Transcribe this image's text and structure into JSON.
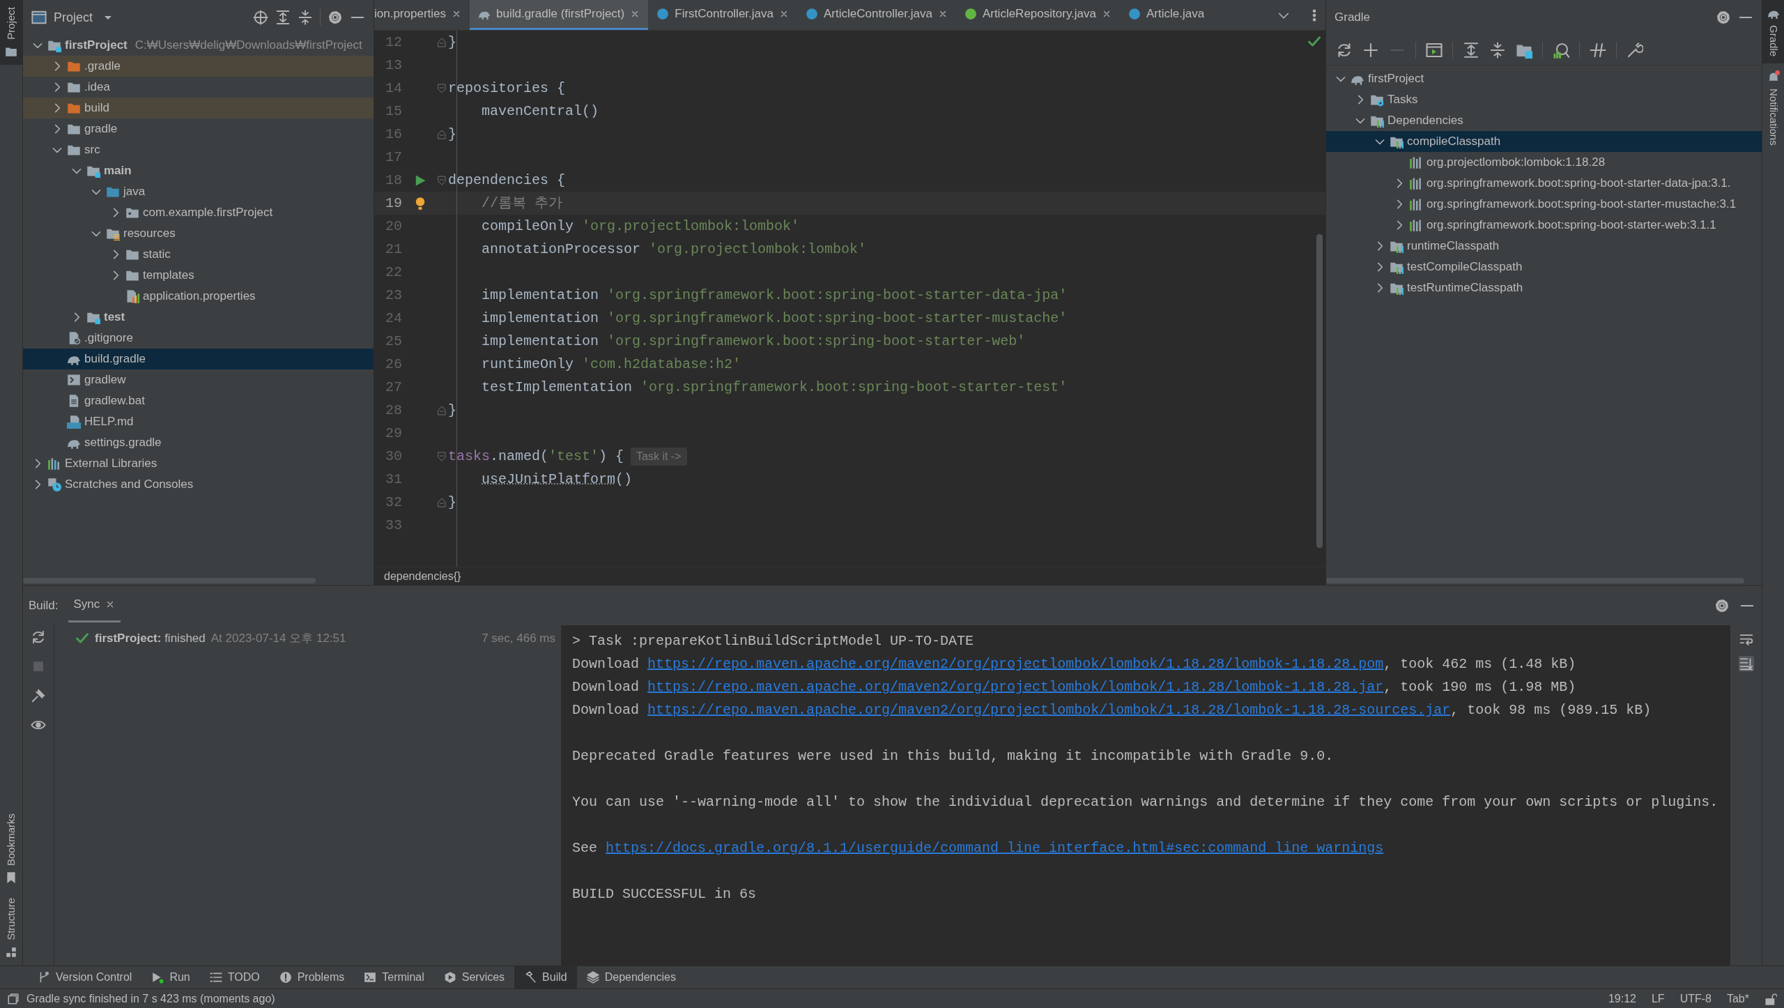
{
  "left_stripe": {
    "top": [
      {
        "label": "Project",
        "selected": true
      }
    ],
    "bottom": [
      {
        "label": "Bookmarks",
        "selected": false
      },
      {
        "label": "Structure",
        "selected": false
      }
    ]
  },
  "right_stripe": [
    {
      "label": "Gradle",
      "selected": true,
      "kind": "gradle",
      "unread": false
    },
    {
      "label": "Notifications",
      "selected": false,
      "kind": "bell",
      "unread": true
    }
  ],
  "project_panel": {
    "title": "Project",
    "tree": [
      {
        "label": "firstProject",
        "kind": "module",
        "path": "C:₩Users₩delig₩Downloads₩firstProject",
        "expanded": true,
        "selected": false,
        "excluded": false,
        "children": [
          {
            "label": ".gradle",
            "kind": "excluded",
            "expanded": false,
            "selected": false,
            "excluded": true
          },
          {
            "label": ".idea",
            "kind": "folder",
            "expanded": false,
            "selected": false,
            "excluded": false
          },
          {
            "label": "build",
            "kind": "excluded",
            "expanded": false,
            "selected": false,
            "excluded": true
          },
          {
            "label": "gradle",
            "kind": "folder",
            "expanded": false,
            "selected": false,
            "excluded": false
          },
          {
            "label": "src",
            "kind": "folder",
            "expanded": true,
            "selected": false,
            "excluded": false,
            "children": [
              {
                "label": "main",
                "kind": "module",
                "expanded": true,
                "selected": false,
                "excluded": false,
                "children": [
                  {
                    "label": "java",
                    "kind": "source",
                    "expanded": true,
                    "selected": false,
                    "excluded": false,
                    "children": [
                      {
                        "label": "com.example.firstProject",
                        "kind": "package",
                        "expanded": false,
                        "selected": false,
                        "excluded": false
                      }
                    ]
                  },
                  {
                    "label": "resources",
                    "kind": "resources",
                    "expanded": true,
                    "selected": false,
                    "excluded": false,
                    "children": [
                      {
                        "label": "static",
                        "kind": "folder",
                        "expanded": false,
                        "selected": false,
                        "excluded": false
                      },
                      {
                        "label": "templates",
                        "kind": "folder",
                        "expanded": false,
                        "selected": false,
                        "excluded": false
                      },
                      {
                        "label": "application.properties",
                        "kind": "properties",
                        "selected": false,
                        "excluded": false
                      }
                    ]
                  }
                ]
              },
              {
                "label": "test",
                "kind": "module",
                "expanded": false,
                "selected": false,
                "excluded": false
              }
            ]
          },
          {
            "label": ".gitignore",
            "kind": "gitignore",
            "selected": false,
            "excluded": false
          },
          {
            "label": "build.gradle",
            "kind": "gradle",
            "selected": true,
            "excluded": false
          },
          {
            "label": "gradlew",
            "kind": "script",
            "selected": false,
            "excluded": false
          },
          {
            "label": "gradlew.bat",
            "kind": "text",
            "selected": false,
            "excluded": false
          },
          {
            "label": "HELP.md",
            "kind": "markdown",
            "selected": false,
            "excluded": false
          },
          {
            "label": "settings.gradle",
            "kind": "gradle",
            "selected": false,
            "excluded": false
          }
        ]
      },
      {
        "label": "External Libraries",
        "kind": "libraries",
        "expanded": false,
        "selected": false,
        "excluded": false
      },
      {
        "label": "Scratches and Consoles",
        "kind": "scratches",
        "expanded": false,
        "selected": false,
        "excluded": false
      }
    ]
  },
  "editor": {
    "tabs": [
      {
        "label": "ion.properties",
        "selected": false,
        "closable": true
      },
      {
        "label": "build.gradle (firstProject)",
        "kind": "gradle",
        "selected": true,
        "closable": true
      },
      {
        "label": "FirstController.java",
        "kind": "class",
        "selected": false,
        "closable": true
      },
      {
        "label": "ArticleController.java",
        "kind": "class",
        "selected": false,
        "closable": true
      },
      {
        "label": "ArticleRepository.java",
        "kind": "interface",
        "selected": false,
        "closable": true
      },
      {
        "label": "Article.java",
        "kind": "class",
        "selected": false,
        "closable": false
      }
    ],
    "lines": [
      {
        "number": "12",
        "current": false,
        "fold_start": false,
        "fold_end": true,
        "run_marker": false,
        "bulb": false,
        "tokens": [
          {
            "text": "}",
            "kind": "plain"
          }
        ]
      },
      {
        "number": "13",
        "current": false,
        "fold_start": false,
        "fold_end": false,
        "run_marker": false,
        "bulb": false
      },
      {
        "number": "14",
        "current": false,
        "fold_start": true,
        "fold_end": false,
        "run_marker": false,
        "bulb": false,
        "tokens": [
          {
            "text": "repositories {",
            "kind": "plain"
          }
        ]
      },
      {
        "number": "15",
        "current": false,
        "fold_start": false,
        "fold_end": false,
        "run_marker": false,
        "bulb": false,
        "tokens": [
          {
            "text": "    mavenCentral()",
            "kind": "plain"
          }
        ]
      },
      {
        "number": "16",
        "current": false,
        "fold_start": false,
        "fold_end": true,
        "run_marker": false,
        "bulb": false,
        "tokens": [
          {
            "text": "}",
            "kind": "plain"
          }
        ]
      },
      {
        "number": "17",
        "current": false,
        "fold_start": false,
        "fold_end": false,
        "run_marker": false,
        "bulb": false
      },
      {
        "number": "18",
        "current": false,
        "fold_start": true,
        "fold_end": false,
        "run_marker": true,
        "bulb": false,
        "tokens": [
          {
            "text": "dependencies {",
            "kind": "plain"
          }
        ]
      },
      {
        "number": "19",
        "current": true,
        "fold_start": false,
        "fold_end": false,
        "run_marker": false,
        "bulb": true,
        "tokens": [
          {
            "text": "    //롬복 추가",
            "kind": "comment"
          }
        ]
      },
      {
        "number": "20",
        "current": false,
        "fold_start": false,
        "fold_end": false,
        "run_marker": false,
        "bulb": false,
        "tokens": [
          {
            "text": "    compileOnly ",
            "kind": "plain"
          },
          {
            "text": "'org.projectlombok:lombok'",
            "kind": "string"
          }
        ]
      },
      {
        "number": "21",
        "current": false,
        "fold_start": false,
        "fold_end": false,
        "run_marker": false,
        "bulb": false,
        "tokens": [
          {
            "text": "    annotationProcessor ",
            "kind": "plain"
          },
          {
            "text": "'org.projectlombok:lombok'",
            "kind": "string"
          }
        ]
      },
      {
        "number": "22",
        "current": false,
        "fold_start": false,
        "fold_end": false,
        "run_marker": false,
        "bulb": false
      },
      {
        "number": "23",
        "current": false,
        "fold_start": false,
        "fold_end": false,
        "run_marker": false,
        "bulb": false,
        "tokens": [
          {
            "text": "    implementation ",
            "kind": "plain"
          },
          {
            "text": "'org.springframework.boot:spring-boot-starter-data-jpa'",
            "kind": "string"
          }
        ]
      },
      {
        "number": "24",
        "current": false,
        "fold_start": false,
        "fold_end": false,
        "run_marker": false,
        "bulb": false,
        "tokens": [
          {
            "text": "    implementation ",
            "kind": "plain"
          },
          {
            "text": "'org.springframework.boot:spring-boot-starter-mustache'",
            "kind": "string"
          }
        ]
      },
      {
        "number": "25",
        "current": false,
        "fold_start": false,
        "fold_end": false,
        "run_marker": false,
        "bulb": false,
        "tokens": [
          {
            "text": "    implementation ",
            "kind": "plain"
          },
          {
            "text": "'org.springframework.boot:spring-boot-starter-web'",
            "kind": "string"
          }
        ]
      },
      {
        "number": "26",
        "current": false,
        "fold_start": false,
        "fold_end": false,
        "run_marker": false,
        "bulb": false,
        "tokens": [
          {
            "text": "    runtimeOnly ",
            "kind": "plain"
          },
          {
            "text": "'com.h2database:h2'",
            "kind": "string"
          }
        ]
      },
      {
        "number": "27",
        "current": false,
        "fold_start": false,
        "fold_end": false,
        "run_marker": false,
        "bulb": false,
        "tokens": [
          {
            "text": "    testImplementation ",
            "kind": "plain"
          },
          {
            "text": "'org.springframework.boot:spring-boot-starter-test'",
            "kind": "string"
          }
        ]
      },
      {
        "number": "28",
        "current": false,
        "fold_start": false,
        "fold_end": true,
        "run_marker": false,
        "bulb": false,
        "tokens": [
          {
            "text": "}",
            "kind": "plain"
          }
        ]
      },
      {
        "number": "29",
        "current": false,
        "fold_start": false,
        "fold_end": false,
        "run_marker": false,
        "bulb": false
      },
      {
        "number": "30",
        "current": false,
        "fold_start": true,
        "fold_end": false,
        "run_marker": false,
        "bulb": false,
        "tokens": [
          {
            "text": "tasks",
            "kind": "keyword"
          },
          {
            "text": ".named(",
            "kind": "plain"
          },
          {
            "text": "'test'",
            "kind": "string"
          },
          {
            "text": ") {",
            "kind": "plain"
          }
        ],
        "hint": "Task it ->"
      },
      {
        "number": "31",
        "current": false,
        "fold_start": false,
        "fold_end": false,
        "run_marker": false,
        "bulb": false,
        "tokens": [
          {
            "text": "    useJUnitPlatform",
            "kind": "method"
          },
          {
            "text": "()",
            "kind": "plain"
          }
        ]
      },
      {
        "number": "32",
        "current": false,
        "fold_start": false,
        "fold_end": true,
        "run_marker": false,
        "bulb": false,
        "tokens": [
          {
            "text": "}",
            "kind": "plain"
          }
        ]
      },
      {
        "number": "33",
        "current": false,
        "fold_start": false,
        "fold_end": false,
        "run_marker": false,
        "bulb": false
      }
    ],
    "breadcrumb": "dependencies{}"
  },
  "gradle_panel": {
    "title": "Gradle",
    "tree": [
      {
        "label": "firstProject",
        "kind": "gradle",
        "expanded": true,
        "selected": false,
        "children": [
          {
            "label": "Tasks",
            "kind": "tasks",
            "expanded": false,
            "selected": false
          },
          {
            "label": "Dependencies",
            "kind": "deps",
            "expanded": true,
            "selected": false,
            "children": [
              {
                "label": "compileClasspath",
                "kind": "deps",
                "expanded": true,
                "selected": true,
                "children": [
                  {
                    "label": "org.projectlombok:lombok:1.18.28",
                    "kind": "library",
                    "selected": false
                  },
                  {
                    "label": "org.springframework.boot:spring-boot-starter-data-jpa:3.1.",
                    "kind": "library",
                    "expanded": false,
                    "selected": false
                  },
                  {
                    "label": "org.springframework.boot:spring-boot-starter-mustache:3.1",
                    "kind": "library",
                    "expanded": false,
                    "selected": false
                  },
                  {
                    "label": "org.springframework.boot:spring-boot-starter-web:3.1.1",
                    "kind": "library",
                    "expanded": false,
                    "selected": false
                  }
                ]
              },
              {
                "label": "runtimeClasspath",
                "kind": "deps",
                "expanded": false,
                "selected": false
              },
              {
                "label": "testCompileClasspath",
                "kind": "deps",
                "expanded": false,
                "selected": false
              },
              {
                "label": "testRuntimeClasspath",
                "kind": "deps",
                "expanded": false,
                "selected": false
              }
            ]
          }
        ]
      }
    ]
  },
  "build_panel": {
    "title": "Build:",
    "tabs": [
      {
        "label": "Sync",
        "selected": true
      }
    ],
    "tree": [
      {
        "label": "**firstProject:** finished",
        "time": "At 2023-07-14 오후 12:51",
        "duration": "7 sec, 466 ms",
        "succeeded": true
      }
    ],
    "output": [
      {
        "lines": [
          {
            "segments": [
              {
                "text": "> Task :prepareKotlinBuildScriptModel UP-TO-DATE",
                "kind": "plain"
              }
            ]
          },
          {
            "segments": [
              {
                "text": "Download ",
                "kind": "plain"
              },
              {
                "text": "https://repo.maven.apache.org/maven2/org/projectlombok/lombok/1.18.28/lombok-1.18.28.pom",
                "kind": "link"
              },
              {
                "text": ", took 462 ms (1.48 kB)",
                "kind": "plain"
              }
            ]
          },
          {
            "segments": [
              {
                "text": "Download ",
                "kind": "plain"
              },
              {
                "text": "https://repo.maven.apache.org/maven2/org/projectlombok/lombok/1.18.28/lombok-1.18.28.jar",
                "kind": "link"
              },
              {
                "text": ", took 190 ms (1.98 MB)",
                "kind": "plain"
              }
            ]
          },
          {
            "segments": [
              {
                "text": "Download ",
                "kind": "plain"
              },
              {
                "text": "https://repo.maven.apache.org/maven2/org/projectlombok/lombok/1.18.28/lombok-1.18.28-sources.jar",
                "kind": "link"
              },
              {
                "text": ", took 98 ms (989.15 kB)",
                "kind": "plain"
              }
            ]
          }
        ]
      },
      {
        "lines": [
          {
            "segments": [
              {
                "text": "Deprecated Gradle features were used in this build, making it incompatible with Gradle 9.0.",
                "kind": "plain"
              }
            ]
          }
        ]
      },
      {
        "lines": [
          {
            "segments": [
              {
                "text": "You can use '--warning-mode all' to show the individual deprecation warnings and determine if they come from your own scripts or plugins.",
                "kind": "plain"
              }
            ]
          }
        ]
      },
      {
        "lines": [
          {
            "segments": [
              {
                "text": "See ",
                "kind": "plain"
              },
              {
                "text": "https://docs.gradle.org/8.1.1/userguide/command_line_interface.html#sec:command_line_warnings",
                "kind": "link"
              }
            ]
          }
        ]
      },
      {
        "lines": [
          {
            "segments": [
              {
                "text": "BUILD SUCCESSFUL in 6s",
                "kind": "plain"
              }
            ]
          }
        ]
      }
    ]
  },
  "tool_windows": [
    {
      "label": "Version Control",
      "kind": "branch",
      "selected": false
    },
    {
      "label": "Run",
      "kind": "run",
      "selected": false
    },
    {
      "label": "TODO",
      "kind": "list",
      "selected": false
    },
    {
      "label": "Problems",
      "kind": "problems",
      "selected": false
    },
    {
      "label": "Terminal",
      "kind": "terminal",
      "selected": false
    },
    {
      "label": "Services",
      "kind": "services",
      "selected": false
    },
    {
      "label": "Build",
      "kind": "hammer",
      "selected": true
    },
    {
      "label": "Dependencies",
      "kind": "layers",
      "selected": false
    }
  ],
  "status_bar": {
    "message": "Gradle sync finished in 7 s 423 ms (moments ago)",
    "items": [
      "19:12",
      "LF",
      "UTF-8",
      "Tab*"
    ]
  }
}
